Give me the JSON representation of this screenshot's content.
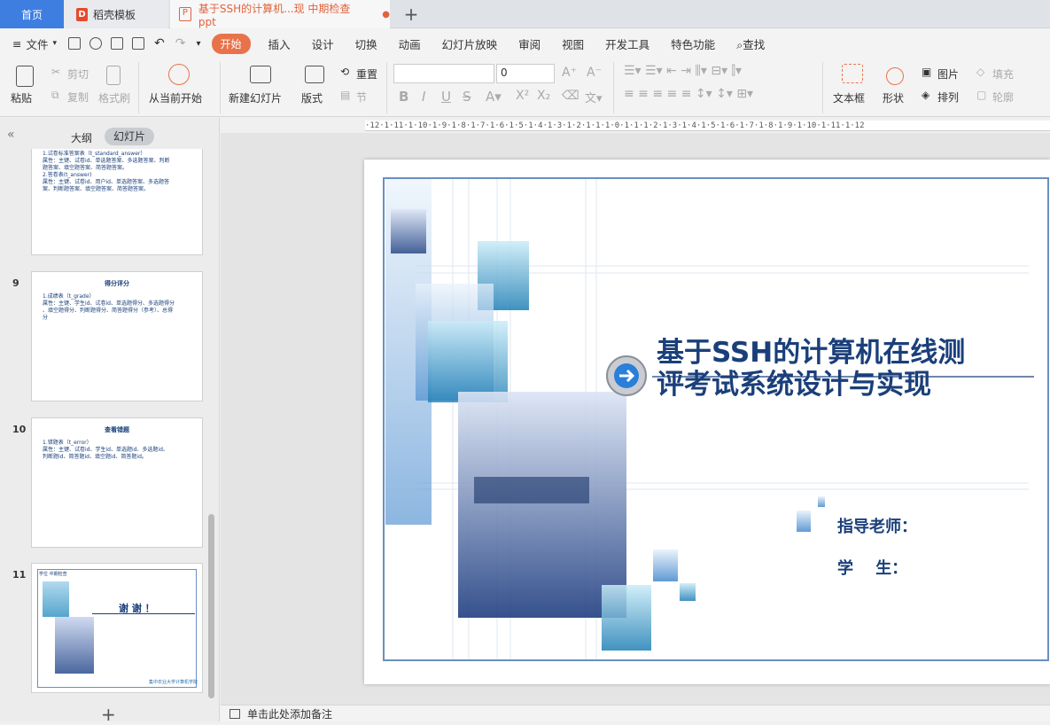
{
  "tabs": {
    "home": "首页",
    "template": "稻壳模板",
    "doc": "基于SSH的计算机...现 中期检查ppt",
    "add": "+"
  },
  "menu": {
    "file": "文件",
    "items": [
      "开始",
      "插入",
      "设计",
      "切换",
      "动画",
      "幻灯片放映",
      "审阅",
      "视图",
      "开发工具",
      "特色功能"
    ],
    "search": "查找"
  },
  "ribbon": {
    "paste": "粘贴",
    "cut": "剪切",
    "copy": "复制",
    "format_painter": "格式刷",
    "play_from_current": "从当前开始",
    "new_slide": "新建幻灯片",
    "layout": "版式",
    "reset": "重置",
    "section": "节",
    "font_size": "0",
    "text_box": "文本框",
    "shape": "形状",
    "picture": "图片",
    "arrange": "排列",
    "fill": "填充",
    "outline": "轮廓"
  },
  "left_pane": {
    "outline": "大纲",
    "slides": "幻灯片",
    "collapse": "«",
    "add": "+"
  },
  "thumbs": [
    {
      "num": "",
      "title": "",
      "lines": [
        "1.试卷标准答案表（t_standard_answer）",
        "  属性：主键、试卷id、单选题答案、多选题答案、判断",
        "  题答案、填空题答案、简答题答案。",
        "2.答卷表(t_answer)",
        "  属性：主键、试卷id、用户id、单选题答案、多选题答",
        "  案、判断题答案、填空题答案、简答题答案。"
      ]
    },
    {
      "num": "9",
      "title": "得分评分",
      "lines": [
        "1.成绩表（t_grade）",
        "  属性：主键、学生id、试卷id、单选题得分、多选题得分",
        "  、填空题得分、判断题得分、简答题得分（参考）、总得",
        "  分"
      ]
    },
    {
      "num": "10",
      "title": "查看错题",
      "lines": [
        "1.错题表（t_error）",
        "  属性：主键、试卷id、学生id、单选题id、多选题id、",
        "  判断题id、简答题id、填空题id、简答题id。"
      ]
    },
    {
      "num": "11",
      "title": "谢 谢 ！",
      "header": "学位 中期检查",
      "footer": "集中农业大学计算机学院"
    }
  ],
  "ruler": "·12·1·11·1·10·1·9·1·8·1·7·1·6·1·5·1·4·1·3·1·2·1·1·1·0·1·1·1·2·1·3·1·4·1·5·1·6·1·7·1·8·1·9·1·10·1·11·1·12",
  "slide": {
    "title_line1": "基于SSH的计算机在线测",
    "title_line2": "评考试系统设计与实现",
    "advisor": "指导老师：",
    "student": "学    生："
  },
  "notes": "单击此处添加备注",
  "colors": {
    "accent": "#e8734a",
    "title": "#1a3f7a",
    "tab_home": "#3d7ee0"
  }
}
